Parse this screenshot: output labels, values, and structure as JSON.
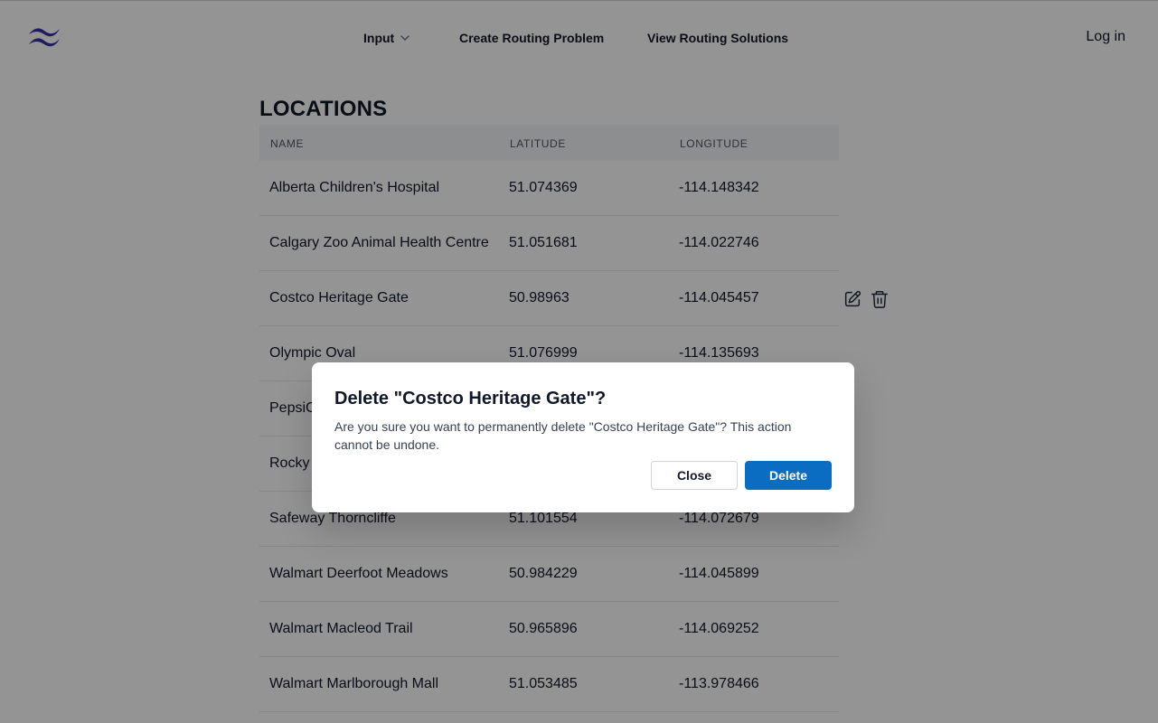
{
  "header": {
    "nav": {
      "input_label": "Input",
      "create_label": "Create Routing Problem",
      "view_label": "View Routing Solutions"
    },
    "login_label": "Log in"
  },
  "locations": {
    "title": "LOCATIONS",
    "columns": {
      "name": "NAME",
      "latitude": "LATITUDE",
      "longitude": "LONGITUDE"
    },
    "rows": [
      {
        "name": "Alberta Children's Hospital",
        "latitude": "51.074369",
        "longitude": "-114.148342"
      },
      {
        "name": "Calgary Zoo Animal Health Centre",
        "latitude": "51.051681",
        "longitude": "-114.022746"
      },
      {
        "name": "Costco Heritage Gate",
        "latitude": "50.98963",
        "longitude": "-114.045457"
      },
      {
        "name": "Olympic Oval",
        "latitude": "51.076999",
        "longitude": "-114.135693"
      },
      {
        "name": "PepsiC",
        "latitude": "",
        "longitude": ""
      },
      {
        "name": "Rocky",
        "latitude": "",
        "longitude": ""
      },
      {
        "name": "Safeway Thorncliffe",
        "latitude": "51.101554",
        "longitude": "-114.072679"
      },
      {
        "name": "Walmart Deerfoot Meadows",
        "latitude": "50.984229",
        "longitude": "-114.045899"
      },
      {
        "name": "Walmart Macleod Trail",
        "latitude": "50.965896",
        "longitude": "-114.069252"
      },
      {
        "name": "Walmart Marlborough Mall",
        "latitude": "51.053485",
        "longitude": "-113.978466"
      }
    ]
  },
  "icons": {
    "logo": "tailwind-logo-icon",
    "chevron": "chevron-down-icon",
    "edit": "pencil-square-icon",
    "delete": "trash-icon"
  },
  "colors": {
    "logo": "#3730a3",
    "primary_button": "#0a6dc2",
    "overlay": "rgba(0,0,0,0.42)"
  },
  "modal": {
    "title": "Delete \"Costco Heritage Gate\"?",
    "body": "Are you sure you want to permanently delete \"Costco Heritage Gate\"? This action cannot be undone.",
    "close_label": "Close",
    "delete_label": "Delete"
  }
}
